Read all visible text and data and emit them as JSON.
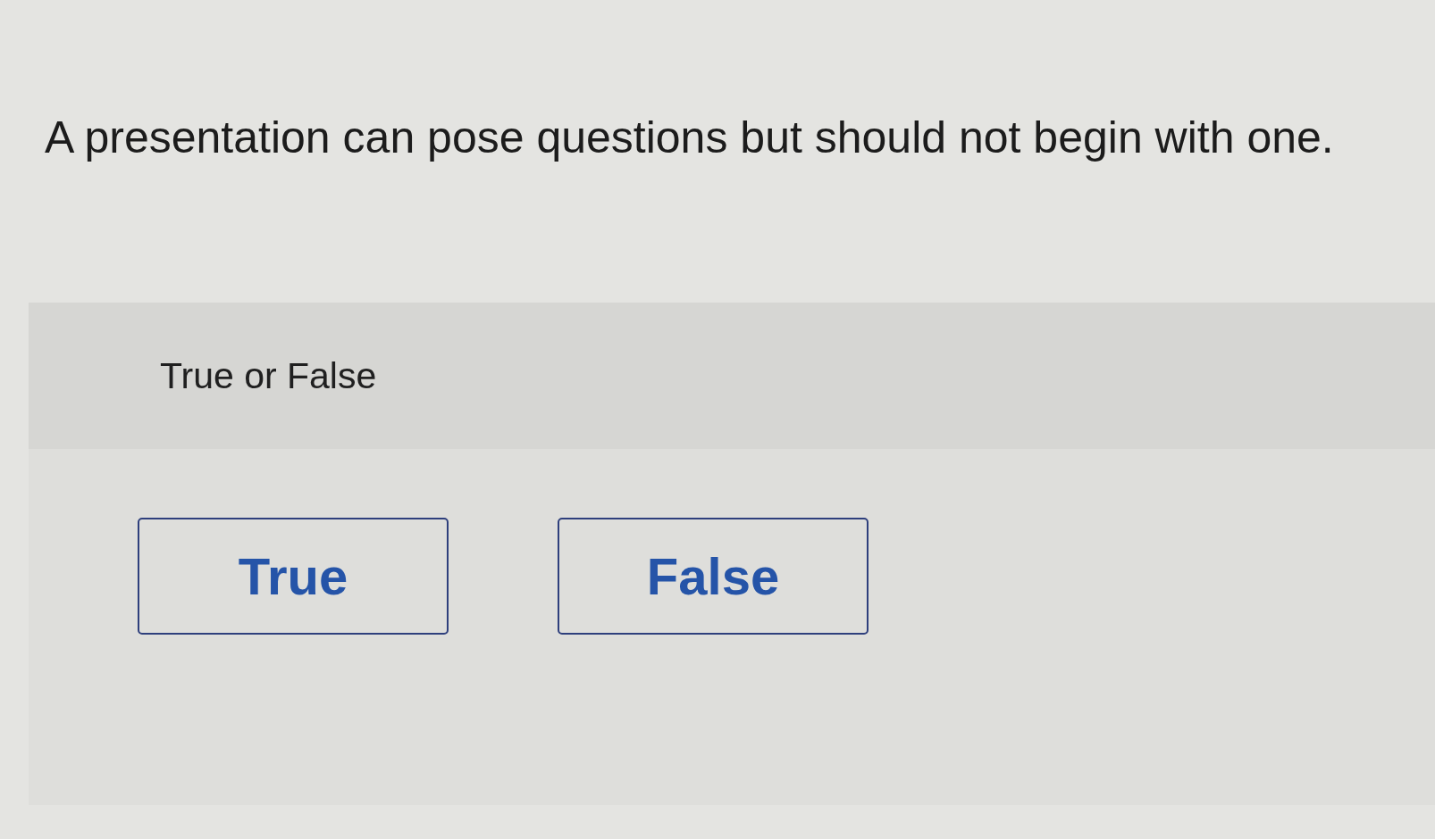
{
  "question": {
    "text": "A presentation can pose questions but should not begin with one."
  },
  "answer_panel": {
    "prompt": "True or False",
    "options": [
      {
        "label": "True",
        "selected": false
      },
      {
        "label": "False",
        "selected": false
      }
    ]
  }
}
